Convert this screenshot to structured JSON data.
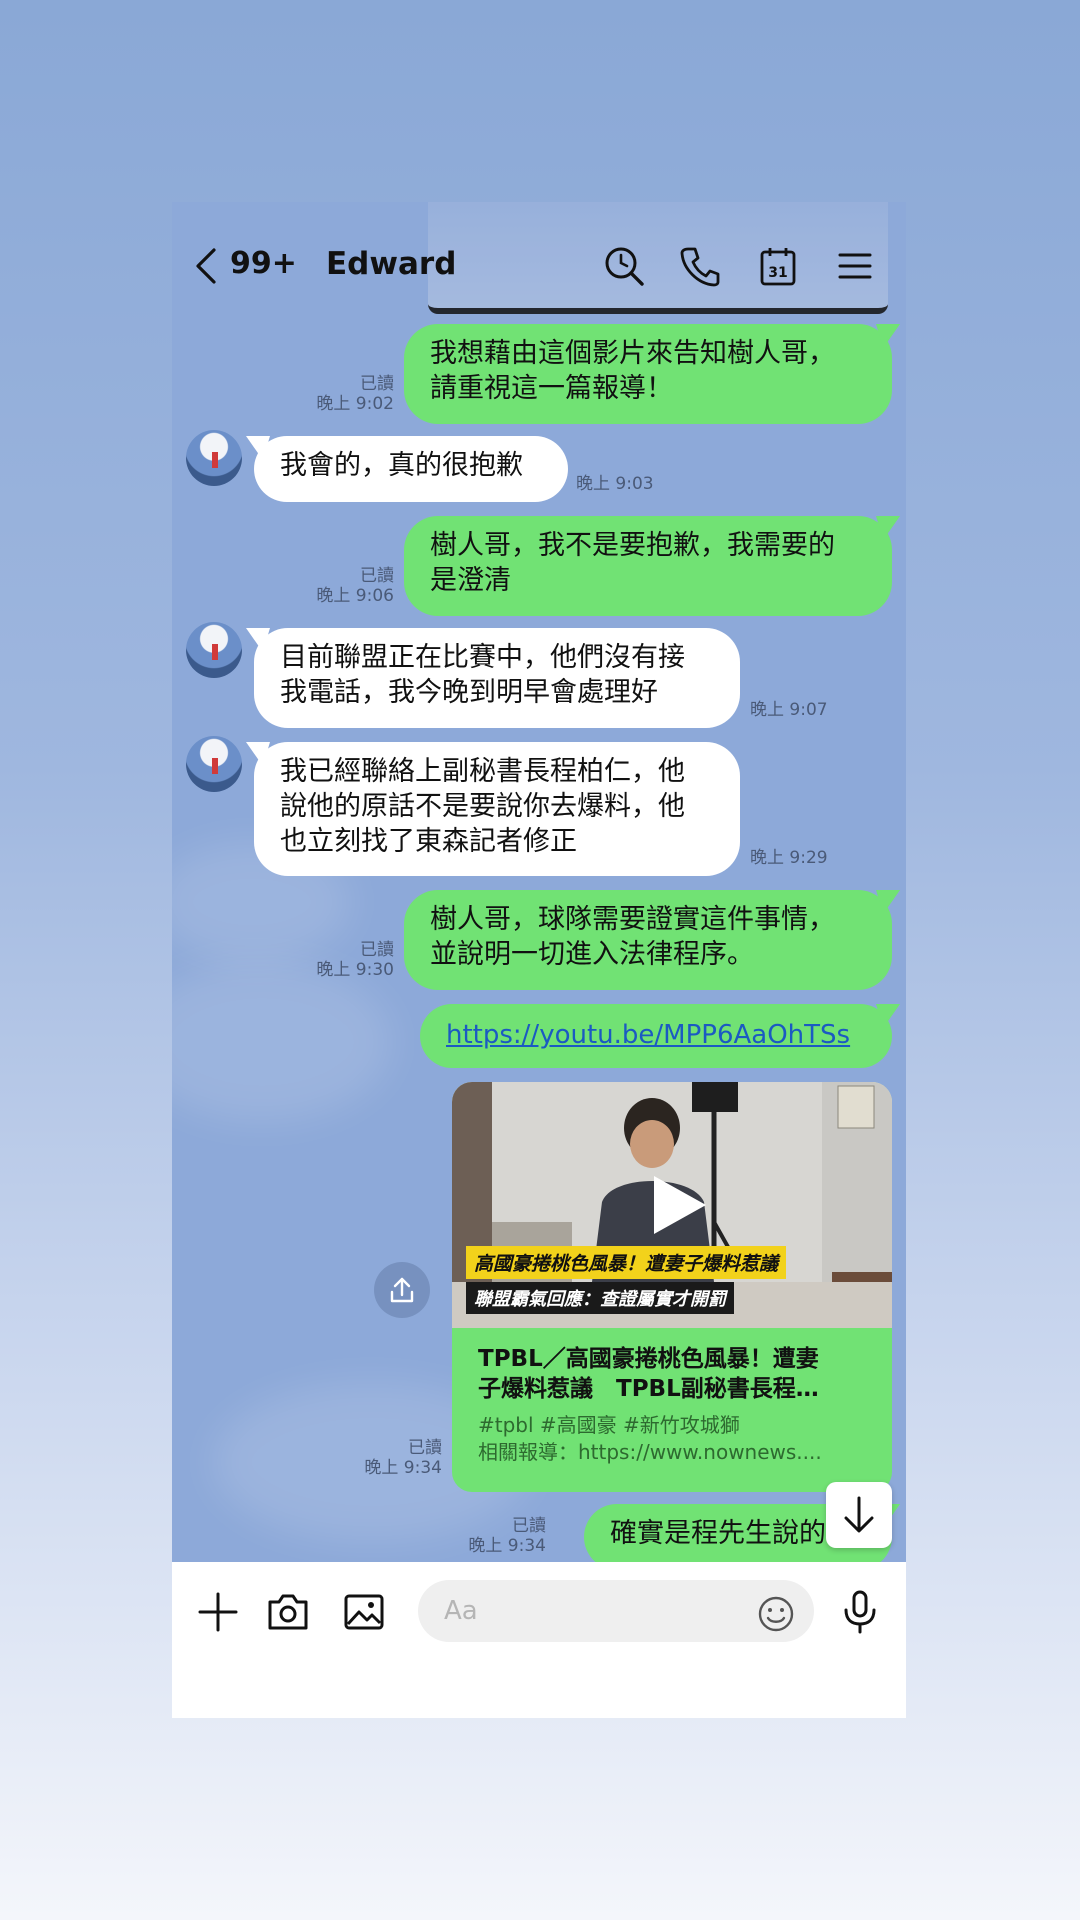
{
  "header": {
    "unread_count": "99+",
    "contact_name": "Edward"
  },
  "messages": [
    {
      "text_lines": [
        "我想藉由這個影片來告知樹人哥，",
        "請重視這一篇報導！"
      ],
      "read": "已讀",
      "time": "晚上 9:02"
    },
    {
      "text": "我會的，真的很抱歉",
      "time": "晚上 9:03"
    },
    {
      "text_lines": [
        "樹人哥，我不是要抱歉，我需要的",
        "是澄清"
      ],
      "read": "已讀",
      "time": "晚上 9:06"
    },
    {
      "text_lines": [
        "目前聯盟正在比賽中，他們沒有接",
        "我電話，我今晚到明早會處理好"
      ],
      "time": "晚上 9:07"
    },
    {
      "text_lines": [
        "我已經聯絡上副秘書長程柏仁，他",
        "說他的原話不是要說你去爆料，他",
        "也立刻找了東森記者修正"
      ],
      "time": "晚上 9:29"
    },
    {
      "text_lines": [
        "樹人哥，球隊需要證實這件事情，",
        "並說明一切進入法律程序。"
      ],
      "read": "已讀",
      "time": "晚上 9:30"
    },
    {
      "link": "https://youtu.be/MPP6AaOhTSs"
    },
    {
      "read": "已讀",
      "time": "晚上 9:34"
    },
    {
      "text": "確實是程先生說的",
      "read": "已讀",
      "time": "晚上 9:34"
    }
  ],
  "video_card": {
    "caption_1": "高國豪捲桃色風暴！遭妻子爆料惹議",
    "caption_2": "聯盟霸氣回應：查證屬實才開罰",
    "title_lines": [
      "TPBL／高國豪捲桃色風暴！遭妻",
      "子爆料惹議　TPBL副秘書長程…"
    ],
    "tags": "#tpbl #高國豪 #新竹攻城獅",
    "related": "相關報導：https://www.nownews...."
  },
  "input": {
    "placeholder": "Aa"
  },
  "icons": {
    "back": "chevron-left-icon",
    "search": "search-icon",
    "call": "phone-icon",
    "calendar": "calendar-icon",
    "calendar_day": "31",
    "menu": "menu-icon",
    "add": "plus-icon",
    "camera": "camera-icon",
    "image": "image-icon",
    "emoji": "emoji-icon",
    "mic": "mic-icon",
    "share": "share-icon",
    "scroll_down": "arrow-down-icon"
  },
  "colors": {
    "chat_background": "#8da9d9",
    "outgoing_bubble": "#71e274",
    "incoming_bubble": "#ffffff",
    "link": "#1b5ac2"
  }
}
